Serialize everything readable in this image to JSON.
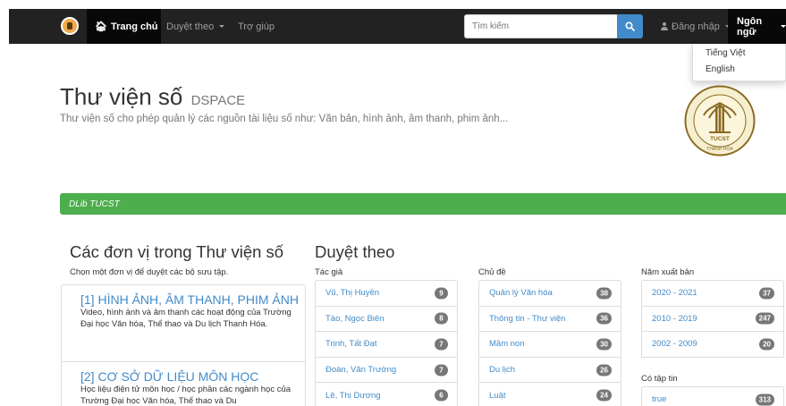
{
  "navbar": {
    "home_label": "Trang chủ",
    "browse_label": "Duyệt theo",
    "help_label": "Trợ giúp",
    "search_placeholder": "Tìm kiếm",
    "login_label": "Đăng nhập",
    "language_label": "Ngôn ngữ"
  },
  "language_menu": {
    "items": [
      "Tiếng Việt",
      "English"
    ]
  },
  "header": {
    "title": "Thư viện số",
    "title_small": "DSPACE",
    "subtitle": "Thư viện số cho phép quản lý các nguồn tài liệu số như: Văn bản, hình ảnh, âm thanh, phim ảnh..."
  },
  "seal": {
    "text": "TUCST",
    "place": "THANH HÓA"
  },
  "breadcrumb": {
    "label": "DLib TUCST"
  },
  "communities": {
    "heading": "Các đơn vị trong Thư viện số",
    "description": "Chọn một đơn vị để duyệt các bộ sưu tập.",
    "items": [
      {
        "title": "[1] HÌNH ẢNH, ÂM THANH, PHIM ẢNH",
        "body": "Video, hình ảnh và âm thanh các hoạt động của Trường Đại học Văn hóa, Thể thao và Du lịch Thanh Hóa."
      },
      {
        "title": "[2] CƠ SỞ DỮ LIỆU MÔN HỌC",
        "body": "Học liệu điện tử môn học / học phần các ngành học của Trường Đại học Văn hóa, Thể thao và Du"
      }
    ]
  },
  "browse": {
    "heading": "Duyệt theo",
    "authors": {
      "label": "Tác giả",
      "items": [
        {
          "name": "Vũ, Thị Huyền",
          "count": "9"
        },
        {
          "name": "Tào, Ngọc Biên",
          "count": "8"
        },
        {
          "name": "Trịnh, Tất Đạt",
          "count": "7"
        },
        {
          "name": "Đoàn, Văn Trường",
          "count": "7"
        },
        {
          "name": "Lê, Thị Dương",
          "count": "6"
        }
      ]
    },
    "subjects": {
      "label": "Chủ đề",
      "items": [
        {
          "name": "Quản lý Văn hóa",
          "count": "38"
        },
        {
          "name": "Thông tin - Thư viện",
          "count": "36"
        },
        {
          "name": "Mầm non",
          "count": "30"
        },
        {
          "name": "Du lịch",
          "count": "26"
        },
        {
          "name": "Luật",
          "count": "24"
        }
      ]
    },
    "years": {
      "label": "Năm xuất bản",
      "items": [
        {
          "name": "2020 - 2021",
          "count": "37"
        },
        {
          "name": "2010 - 2019",
          "count": "247"
        },
        {
          "name": "2002 - 2009",
          "count": "20"
        }
      ]
    },
    "has_files": {
      "label": "Có tập tin",
      "items": [
        {
          "name": "true",
          "count": "313"
        }
      ]
    }
  }
}
